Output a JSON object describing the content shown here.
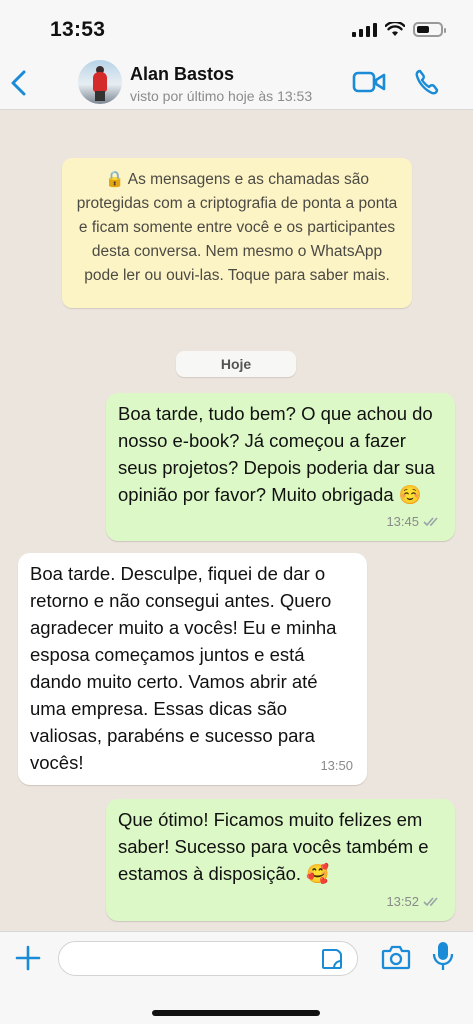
{
  "status_bar": {
    "time": "13:53"
  },
  "header": {
    "contact_name": "Alan Bastos",
    "last_seen": "visto por último hoje às 13:53",
    "accent_color": "#1a8bd6"
  },
  "encryption_notice": {
    "text": "🔒 As mensagens e as chamadas são protegidas com a criptografia de ponta a ponta e ficam somente entre você e os participantes desta conversa. Nem mesmo o WhatsApp pode ler ou ouvi-las. Toque para saber mais."
  },
  "date_chip": "Hoje",
  "messages": [
    {
      "direction": "outgoing",
      "text": "Boa tarde, tudo bem? O que achou do nosso e-book? Já começou a fazer seus projetos? Depois poderia dar sua opinião por favor? Muito obrigada ☺️",
      "time": "13:45",
      "status": "read"
    },
    {
      "direction": "incoming",
      "text": "Boa tarde. Desculpe, fiquei de dar o retorno e não consegui antes. Quero agradecer muito a vocês! Eu e minha esposa começamos juntos e está dando muito certo. Vamos abrir até uma empresa. Essas dicas são valiosas, parabéns e sucesso para vocês!",
      "time": "13:50"
    },
    {
      "direction": "outgoing",
      "text": "Que ótimo! Ficamos muito felizes em saber! Sucesso para vocês também e estamos à disposição. 🥰",
      "time": "13:52",
      "status": "read"
    }
  ],
  "input_bar": {
    "placeholder": "",
    "icons": [
      "plus-icon",
      "sticker-icon",
      "camera-icon",
      "microphone-icon"
    ]
  },
  "colors": {
    "outgoing_bubble": "#dcf8c6",
    "incoming_bubble": "#ffffff",
    "chat_background": "#ece5dd",
    "notice_background": "#fdf4c5"
  }
}
